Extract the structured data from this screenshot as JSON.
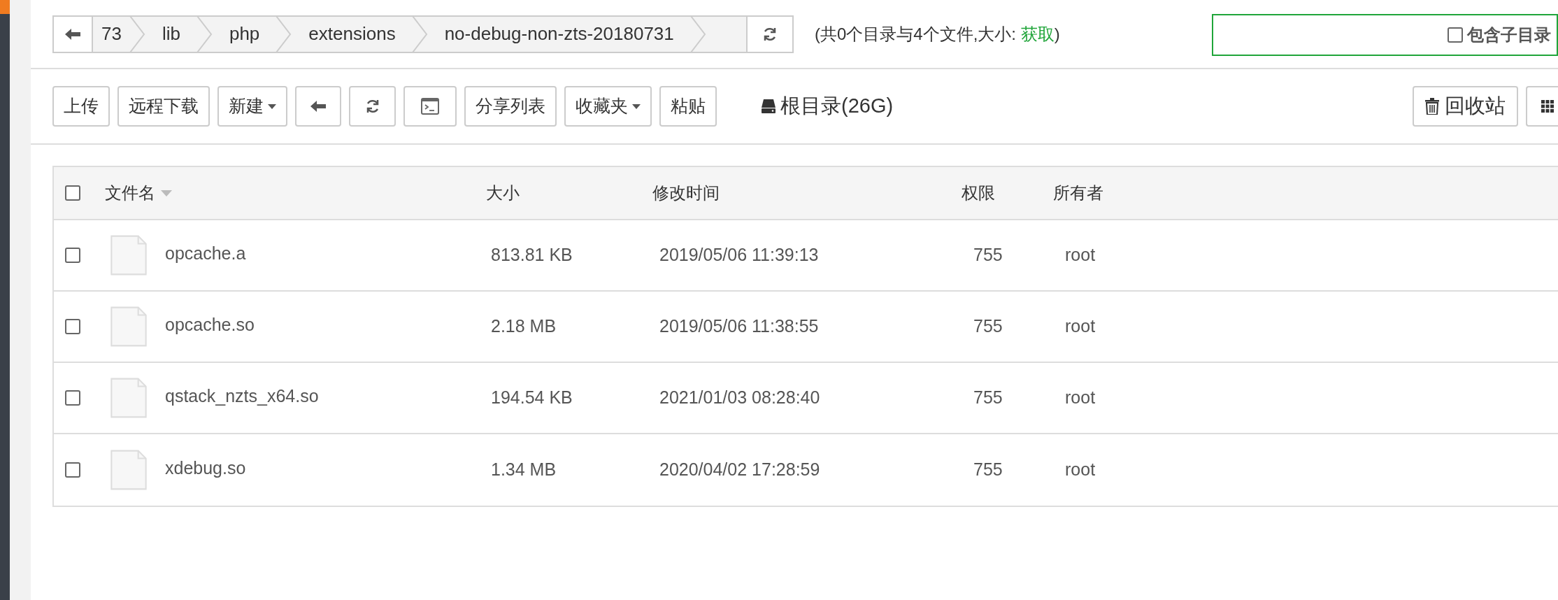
{
  "breadcrumb": {
    "segments": [
      "73",
      "lib",
      "php",
      "extensions",
      "no-debug-non-zts-20180731"
    ]
  },
  "summary": {
    "before": "(共0个目录与4个文件,大小: ",
    "link": "获取",
    "after": ")"
  },
  "search": {
    "include_subdirs": {
      "label": "包含子目录",
      "checked": false
    }
  },
  "toolbar": [
    {
      "kind": "text",
      "label": "上传"
    },
    {
      "kind": "text",
      "label": "远程下载"
    },
    {
      "kind": "dropdown",
      "label": "新建"
    },
    {
      "kind": "back"
    },
    {
      "kind": "refresh"
    },
    {
      "kind": "terminal"
    },
    {
      "kind": "text",
      "label": "分享列表"
    },
    {
      "kind": "dropdown",
      "label": "收藏夹"
    },
    {
      "kind": "text",
      "label": "粘贴"
    }
  ],
  "disk": "根目录(26G)",
  "recycle_bin": "回收站",
  "table": {
    "select_all": false,
    "columns": [
      "文件名",
      "大小",
      "修改时间",
      "权限",
      "所有者"
    ],
    "rows": [
      {
        "checked": false,
        "name": "opcache.a",
        "size": "813.81 KB",
        "modified": "2019/05/06 11:39:13",
        "permission": "755",
        "owner": "root"
      },
      {
        "checked": false,
        "name": "opcache.so",
        "size": "2.18 MB",
        "modified": "2019/05/06 11:38:55",
        "permission": "755",
        "owner": "root"
      },
      {
        "checked": false,
        "name": "qstack_nzts_x64.so",
        "size": "194.54 KB",
        "modified": "2021/01/03 08:28:40",
        "permission": "755",
        "owner": "root"
      },
      {
        "checked": false,
        "name": "xdebug.so",
        "size": "1.34 MB",
        "modified": "2020/04/02 17:28:59",
        "permission": "755",
        "owner": "root"
      }
    ]
  }
}
